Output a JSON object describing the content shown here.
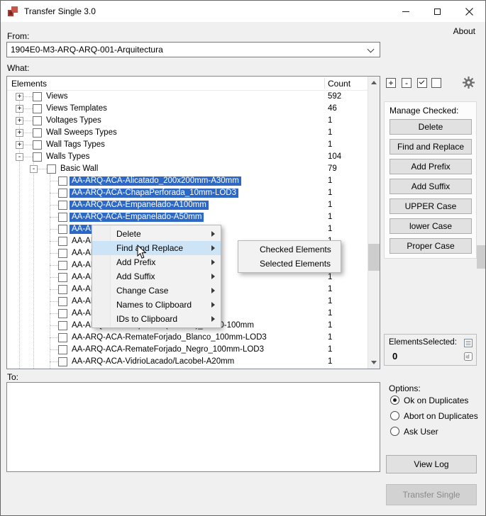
{
  "colors": {
    "selection": "#2d68c4",
    "menu_highlight": "#cde4f7",
    "window_bg": "#f0f0f0",
    "titlebar_bg": "#ffffff",
    "button_bg": "#e1e1e1",
    "button_border": "#adadad",
    "disabled_bg": "#d2d2d2",
    "disabled_text": "#8a8a8a",
    "app_icon_red": "#a8392e"
  },
  "window": {
    "title": "Transfer Single 3.0",
    "about_label": "About",
    "controls": [
      "minimize",
      "maximize",
      "close"
    ]
  },
  "from": {
    "label": "From:",
    "value": "1904E0-M3-ARQ-ARQ-001-Arquitectura"
  },
  "what": {
    "label": "What:"
  },
  "tree": {
    "header": {
      "elements": "Elements",
      "count": "Count"
    },
    "rows": [
      {
        "label": "Views",
        "count": "592",
        "level": 1,
        "glyph": "plus",
        "selected": false
      },
      {
        "label": "Views Templates",
        "count": "46",
        "level": 1,
        "glyph": "plus",
        "selected": false
      },
      {
        "label": "Voltages Types",
        "count": "1",
        "level": 1,
        "glyph": "plus",
        "selected": false
      },
      {
        "label": "Wall Sweeps Types",
        "count": "1",
        "level": 1,
        "glyph": "plus",
        "selected": false
      },
      {
        "label": "Wall Tags Types",
        "count": "1",
        "level": 1,
        "glyph": "plus",
        "selected": false
      },
      {
        "label": "Walls Types",
        "count": "104",
        "level": 1,
        "glyph": "minus",
        "selected": false
      },
      {
        "label": "Basic Wall",
        "count": "79",
        "level": 2,
        "glyph": "minus",
        "selected": false
      },
      {
        "label": "AA-ARQ-ACA-Alicatado_200x200mm-A30mm",
        "count": "1",
        "level": 3,
        "glyph": "none",
        "selected": true
      },
      {
        "label": "AA-ARQ-ACA-ChapaPerforada_10mm-LOD3",
        "count": "1",
        "level": 3,
        "glyph": "none",
        "selected": true
      },
      {
        "label": "AA-ARQ-ACA-Empanelado-A100mm",
        "count": "1",
        "level": 3,
        "glyph": "none",
        "selected": true
      },
      {
        "label": "AA-ARQ-ACA-Empanelado-A50mm",
        "count": "1",
        "level": 3,
        "glyph": "none",
        "selected": true
      },
      {
        "label": "AA-ARQ-ACA-",
        "count": "1",
        "level": 3,
        "glyph": "none",
        "selected": true
      },
      {
        "label": "AA-ARQ-ACA-",
        "count": "1",
        "level": 3,
        "glyph": "none",
        "selected": false
      },
      {
        "label": "AA-ARQ-ACA-",
        "count": "1",
        "level": 3,
        "glyph": "none",
        "selected": false
      },
      {
        "label": "AA-ARQ-ACA-",
        "count": "1",
        "level": 3,
        "glyph": "none",
        "selected": false
      },
      {
        "label": "AA-ARQ-ACA-",
        "count": "1",
        "level": 3,
        "glyph": "none",
        "selected": false
      },
      {
        "label": "AA-ARQ-ACA-",
        "count": "1",
        "level": 3,
        "glyph": "none",
        "selected": false
      },
      {
        "label": "AA-ARQ-ACA-",
        "count": "1",
        "level": 3,
        "glyph": "none",
        "selected": false
      },
      {
        "label": "AA-ARQ-ACA-",
        "count": "1",
        "level": 3,
        "glyph": "none",
        "selected": false
      },
      {
        "label": "AA-ARQ-ACA-Carpinteria(Adefinir)_EI120-100mm",
        "count": "1",
        "level": 3,
        "glyph": "none",
        "selected": false
      },
      {
        "label": "AA-ARQ-ACA-RemateForjado_Blanco_100mm-LOD3",
        "count": "1",
        "level": 3,
        "glyph": "none",
        "selected": false
      },
      {
        "label": "AA-ARQ-ACA-RemateForjado_Negro_100mm-LOD3",
        "count": "1",
        "level": 3,
        "glyph": "none",
        "selected": false
      },
      {
        "label": "AA-ARQ-ACA-VidrioLacado/Lacobel-A20mm",
        "count": "1",
        "level": 3,
        "glyph": "none",
        "selected": false
      }
    ]
  },
  "toolbar": {
    "buttons": [
      {
        "name": "add-button",
        "icon": "plus-icon",
        "type": "plus",
        "glyph": "+"
      },
      {
        "name": "remove-button",
        "icon": "minus-icon",
        "type": "minus",
        "glyph": "-"
      },
      {
        "name": "check-all-button",
        "icon": "checked-checkbox-icon",
        "type": "check",
        "glyph": ""
      },
      {
        "name": "uncheck-all-button",
        "icon": "empty-checkbox-icon",
        "type": "empty",
        "glyph": ""
      },
      {
        "name": "settings-button",
        "icon": "gear-icon",
        "type": "gear",
        "glyph": ""
      }
    ]
  },
  "context_menu": {
    "items": [
      {
        "label": "Delete",
        "highlighted": false
      },
      {
        "label": "Find and Replace",
        "highlighted": true
      },
      {
        "label": "Add Prefix",
        "highlighted": false
      },
      {
        "label": "Add Suffix",
        "highlighted": false
      },
      {
        "label": "Change Case",
        "highlighted": false
      },
      {
        "label": "Names to Clipboard",
        "highlighted": false
      },
      {
        "label": "IDs to Clipboard",
        "highlighted": false
      }
    ],
    "submenu": {
      "items": [
        "Checked Elements",
        "Selected Elements"
      ]
    }
  },
  "right_panel": {
    "manage_checked_label": "Manage Checked:",
    "buttons": [
      "Delete",
      "Find and Replace",
      "Add Prefix",
      "Add Suffix",
      "UPPER Case",
      "lower Case",
      "Proper Case"
    ],
    "elements_selected": {
      "label": "ElementsSelected:",
      "value": "0"
    }
  },
  "to": {
    "label": "To:"
  },
  "options": {
    "label": "Options:",
    "radios": [
      {
        "label": "Ok on Duplicates",
        "checked": true
      },
      {
        "label": "Abort on Duplicates",
        "checked": false
      },
      {
        "label": "Ask User",
        "checked": false
      }
    ],
    "view_log_label": "View Log",
    "transfer_label": "Transfer Single"
  }
}
